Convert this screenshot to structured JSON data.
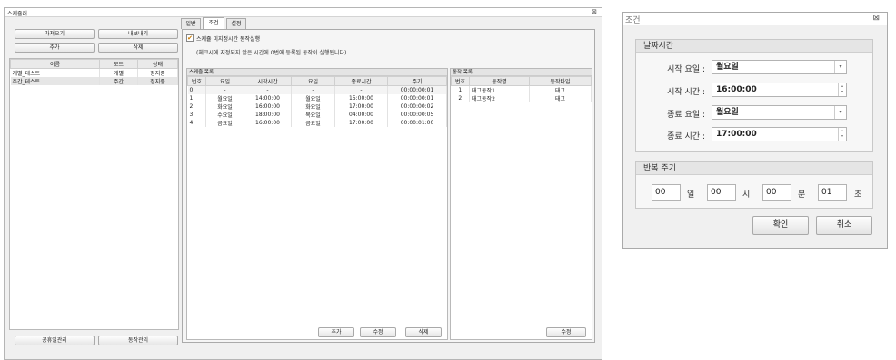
{
  "main_window": {
    "title": "스케쥴러",
    "close_glyph": "⊠"
  },
  "left": {
    "import_label": "가져오기",
    "export_label": "내보내기",
    "add_label": "추가",
    "delete_label": "삭제",
    "columns": [
      "이름",
      "모드",
      "상태"
    ],
    "rows": [
      [
        "개별_테스트",
        "개별",
        "정지중"
      ],
      [
        "주간_테스트",
        "주간",
        "정지중"
      ]
    ],
    "holiday_label": "공휴일관리",
    "action_label": "동작관리"
  },
  "tabs": [
    "일반",
    "조건",
    "설정"
  ],
  "condition": {
    "checkbox_label": "스케쥴 미지정시간 동작실행",
    "note": "(체크시에 지정되지 않은 시간에 0번에 등록된 동작이 실행됩니다)",
    "schedule_header": "스케쥴 목록",
    "schedule_columns": [
      "번호",
      "요일",
      "시작시간",
      "요일",
      "종료시간",
      "주기"
    ],
    "schedule_rows": [
      [
        "0",
        "-",
        "-",
        "-",
        "-",
        "00:00:00:01"
      ],
      [
        "1",
        "월요일",
        "14:00:00",
        "월요일",
        "15:00:00",
        "00:00:00:01"
      ],
      [
        "2",
        "화요일",
        "16:00:00",
        "화요일",
        "17:00:00",
        "00:00:00:02"
      ],
      [
        "3",
        "수요일",
        "18:00:00",
        "목요일",
        "04:00:00",
        "00:00:00:05"
      ],
      [
        "4",
        "금요일",
        "16:00:00",
        "금요일",
        "17:00:00",
        "00:00:01:00"
      ]
    ],
    "add_label": "추가",
    "edit_label": "수정",
    "delete_label": "삭제",
    "action_header": "동작 목록",
    "action_columns": [
      "번호",
      "동작명",
      "동작타입"
    ],
    "action_rows": [
      [
        "1",
        "태그동작1",
        "태그"
      ],
      [
        "2",
        "태그동작2",
        "태그"
      ]
    ],
    "action_edit_label": "수정"
  },
  "dialog": {
    "title": "조건",
    "close_glyph": "⊠",
    "datetime_header": "날짜시간",
    "start_day_label": "시작 요일 :",
    "start_day_value": "월요일",
    "start_time_label": "시작 시간 :",
    "start_time_value": "16:00:00",
    "end_day_label": "종료 요일 :",
    "end_day_value": "월요일",
    "end_time_label": "종료 시간 :",
    "end_time_value": "17:00:00",
    "repeat_header": "반복 주기",
    "day_value": "00",
    "day_unit": "일",
    "hour_value": "00",
    "hour_unit": "시",
    "min_value": "00",
    "min_unit": "분",
    "sec_value": "01",
    "sec_unit": "초",
    "ok_label": "확인",
    "cancel_label": "취소"
  },
  "icons": {
    "dropdown": "▾",
    "spin_up": "▴",
    "spin_down": "▾",
    "checkmark": "✔"
  }
}
